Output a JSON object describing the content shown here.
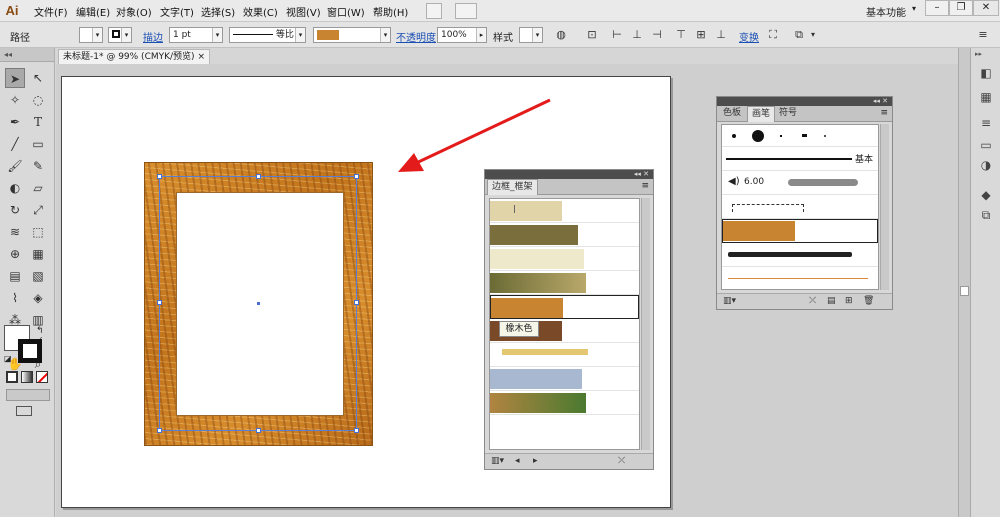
{
  "app": {
    "logo": "Ai",
    "menus": [
      "文件(F)",
      "编辑(E)",
      "对象(O)",
      "文字(T)",
      "选择(S)",
      "效果(C)",
      "视图(V)",
      "窗口(W)",
      "帮助(H)"
    ],
    "workspace": "基本功能",
    "window_controls": [
      "minimize-icon",
      "restore-icon",
      "close-icon"
    ]
  },
  "control_bar": {
    "selection_type": "路径",
    "stroke_label": "描边",
    "stroke_weight": "1 pt",
    "profile_label": "等比",
    "opacity_label": "不透明度",
    "opacity_value": "100%",
    "style_label": "样式",
    "transform_label": "变换"
  },
  "document": {
    "tab_title": "未标题-1* @ 99% (CMYK/预览)",
    "tab_close": "×"
  },
  "border_panel": {
    "title": "边框_框架",
    "tooltip": "橡木色",
    "footer_icons": [
      "library-menu-icon",
      "prev-arrow-icon",
      "next-arrow-icon",
      "break-link-icon"
    ]
  },
  "brush_panel": {
    "tabs": [
      "色板",
      "画笔",
      "符号"
    ],
    "active_tab": "画笔",
    "basic_label": "基本",
    "size_value": "6.00",
    "footer_icons": [
      "library-menu-icon",
      "remove-stroke-icon",
      "options-icon",
      "new-brush-icon",
      "delete-icon"
    ]
  },
  "colors": {
    "wood_light": "#d98f2e",
    "wood_dark": "#b86a18",
    "selection": "#4a6fcf",
    "annotation_arrow": "#e31b1b",
    "link": "#1a4fb3"
  }
}
